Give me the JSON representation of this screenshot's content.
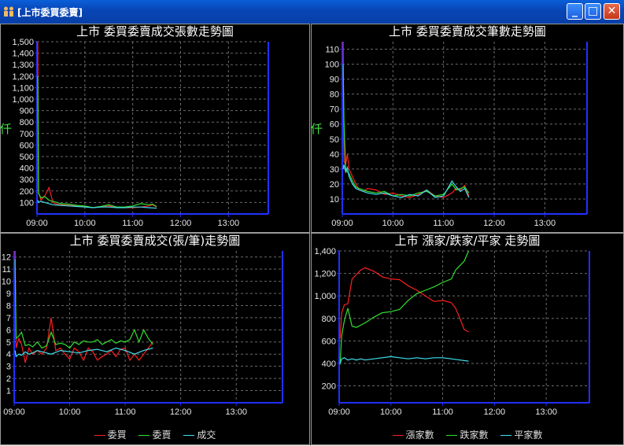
{
  "window": {
    "title": "[上市委買委賣]",
    "minimize_glyph": "_",
    "maximize_glyph": "□",
    "close_glyph": "✕"
  },
  "chart_data": [
    {
      "type": "line",
      "title": "上市 委買委賣成交張數走勢圖",
      "ylabel": "仟",
      "ylim": [
        0,
        1500
      ],
      "yticks": [
        100,
        200,
        300,
        400,
        500,
        600,
        700,
        800,
        900,
        1000,
        1100,
        1200,
        1300,
        1400,
        1500
      ],
      "ytick_labels": [
        "100",
        "200",
        "300",
        "400",
        "500",
        "600",
        "700",
        "800",
        "900",
        "1,000",
        "1,100",
        "1,200",
        "1,300",
        "1,400",
        "1,500"
      ],
      "xticks": [
        "09:00",
        "10:00",
        "11:00",
        "12:00",
        "13:00"
      ],
      "xlim": [
        "09:00",
        "13:50"
      ],
      "grid": true,
      "series": [
        {
          "color": "#ff2020",
          "x": [
            "09:01",
            "09:02",
            "09:05",
            "09:10",
            "09:15",
            "09:20",
            "09:25",
            "09:30",
            "09:40",
            "09:50",
            "10:00",
            "10:10",
            "10:20",
            "10:30",
            "10:40",
            "10:50",
            "11:00",
            "11:10",
            "11:20",
            "11:25",
            "11:30"
          ],
          "values": [
            1500,
            190,
            120,
            160,
            230,
            100,
            85,
            80,
            75,
            70,
            65,
            55,
            60,
            70,
            60,
            55,
            55,
            60,
            70,
            80,
            60
          ]
        },
        {
          "color": "#30e030",
          "x": [
            "09:01",
            "09:02",
            "09:05",
            "09:10",
            "09:15",
            "09:20",
            "09:25",
            "09:30",
            "09:40",
            "09:50",
            "10:00",
            "10:10",
            "10:20",
            "10:30",
            "10:40",
            "10:50",
            "11:00",
            "11:10",
            "11:20",
            "11:25",
            "11:30"
          ],
          "values": [
            1200,
            180,
            140,
            150,
            120,
            110,
            100,
            90,
            85,
            75,
            70,
            55,
            65,
            80,
            60,
            60,
            70,
            90,
            80,
            85,
            65
          ]
        },
        {
          "color": "#40e0f0",
          "x": [
            "09:01",
            "09:02",
            "09:05",
            "09:10",
            "09:15",
            "09:20",
            "09:30",
            "09:40",
            "09:50",
            "10:00",
            "10:10",
            "10:20",
            "10:30",
            "10:40",
            "10:50",
            "11:00",
            "11:10",
            "11:20",
            "11:30"
          ],
          "values": [
            120,
            100,
            110,
            100,
            90,
            80,
            75,
            70,
            65,
            60,
            55,
            60,
            60,
            55,
            55,
            60,
            60,
            55,
            50
          ]
        }
      ]
    },
    {
      "type": "line",
      "title": "上市 委買委賣成交筆數走勢圖",
      "ylabel": "仟",
      "ylim": [
        0,
        115
      ],
      "yticks": [
        10,
        20,
        30,
        40,
        50,
        60,
        70,
        80,
        90,
        100,
        110
      ],
      "ytick_labels": [
        "10",
        "20",
        "30",
        "40",
        "50",
        "60",
        "70",
        "80",
        "90",
        "100",
        "110"
      ],
      "xticks": [
        "09:00",
        "10:00",
        "11:00",
        "12:00",
        "13:00"
      ],
      "xlim": [
        "09:00",
        "13:50"
      ],
      "grid": true,
      "series": [
        {
          "color": "#ff2020",
          "x": [
            "09:01",
            "09:02",
            "09:04",
            "09:06",
            "09:08",
            "09:12",
            "09:16",
            "09:20",
            "09:25",
            "09:30",
            "09:40",
            "09:50",
            "10:00",
            "10:10",
            "10:20",
            "10:30",
            "10:40",
            "10:50",
            "11:00",
            "11:10",
            "11:15",
            "11:20",
            "11:25",
            "11:30"
          ],
          "values": [
            115,
            35,
            33,
            40,
            30,
            25,
            20,
            16,
            15,
            17,
            16,
            13,
            14,
            12,
            11,
            13,
            16,
            12,
            11,
            14,
            17,
            16,
            19,
            12
          ]
        },
        {
          "color": "#30e030",
          "x": [
            "09:01",
            "09:02",
            "09:04",
            "09:06",
            "09:08",
            "09:12",
            "09:16",
            "09:20",
            "09:25",
            "09:30",
            "09:40",
            "09:50",
            "10:00",
            "10:10",
            "10:20",
            "10:30",
            "10:40",
            "10:50",
            "11:00",
            "11:10",
            "11:15",
            "11:20",
            "11:25",
            "11:30"
          ],
          "values": [
            100,
            62,
            30,
            28,
            27,
            22,
            18,
            17,
            16,
            15,
            14,
            15,
            12,
            13,
            12,
            14,
            15,
            12,
            13,
            20,
            16,
            17,
            18,
            14
          ]
        },
        {
          "color": "#40e0f0",
          "x": [
            "09:01",
            "09:02",
            "09:04",
            "09:06",
            "09:08",
            "09:12",
            "09:16",
            "09:20",
            "09:25",
            "09:30",
            "09:40",
            "09:50",
            "10:00",
            "10:10",
            "10:20",
            "10:30",
            "10:40",
            "10:50",
            "11:00",
            "11:10",
            "11:15",
            "11:20",
            "11:25",
            "11:30"
          ],
          "values": [
            30,
            33,
            28,
            31,
            25,
            20,
            17,
            16,
            15,
            14,
            13,
            14,
            12,
            11,
            13,
            12,
            16,
            11,
            12,
            22,
            18,
            15,
            17,
            11
          ]
        }
      ]
    },
    {
      "type": "line",
      "title": "上市 委買委賣成交(張/筆)走勢圖",
      "ylim": [
        0,
        12.5
      ],
      "yticks": [
        1,
        2,
        3,
        4,
        5,
        6,
        7,
        8,
        9,
        10,
        11,
        12
      ],
      "ytick_labels": [
        "1",
        "2",
        "3",
        "4",
        "5",
        "6",
        "7",
        "8",
        "9",
        "10",
        "11",
        "12"
      ],
      "xticks": [
        "09:00",
        "10:00",
        "11:00",
        "12:00",
        "13:00"
      ],
      "xlim": [
        "09:00",
        "13:50"
      ],
      "grid": true,
      "legend": [
        "委買",
        "委賣",
        "成交"
      ],
      "legend_position": "bottom",
      "series": [
        {
          "name": "委買",
          "color": "#ff2020",
          "x": [
            "09:01",
            "09:02",
            "09:05",
            "09:08",
            "09:12",
            "09:16",
            "09:20",
            "09:25",
            "09:30",
            "09:35",
            "09:40",
            "09:45",
            "09:50",
            "09:55",
            "10:00",
            "10:05",
            "10:10",
            "10:15",
            "10:20",
            "10:25",
            "10:30",
            "10:35",
            "10:40",
            "10:45",
            "10:50",
            "10:55",
            "11:00",
            "11:05",
            "11:10",
            "11:15",
            "11:20",
            "11:25",
            "11:30"
          ],
          "values": [
            12.5,
            4.5,
            5.3,
            4.8,
            3.3,
            4.5,
            4.0,
            4.3,
            4.0,
            4.5,
            7.0,
            4.3,
            4.5,
            4.0,
            3.6,
            4.5,
            4.2,
            3.5,
            4.5,
            4.2,
            3.5,
            3.8,
            4.0,
            4.3,
            3.8,
            4.4,
            4.5,
            3.5,
            4.0,
            3.5,
            4.0,
            4.5,
            5.0
          ]
        },
        {
          "name": "委賣",
          "color": "#30e030",
          "x": [
            "09:01",
            "09:02",
            "09:05",
            "09:08",
            "09:12",
            "09:16",
            "09:20",
            "09:25",
            "09:30",
            "09:35",
            "09:40",
            "09:45",
            "09:50",
            "09:55",
            "10:00",
            "10:05",
            "10:10",
            "10:15",
            "10:20",
            "10:25",
            "10:30",
            "10:35",
            "10:40",
            "10:45",
            "10:50",
            "10:55",
            "11:00",
            "11:05",
            "11:10",
            "11:15",
            "11:20",
            "11:25",
            "11:30"
          ],
          "values": [
            11.8,
            5.3,
            5.5,
            5.8,
            4.7,
            4.8,
            4.6,
            5.0,
            4.5,
            4.7,
            5.8,
            4.8,
            4.9,
            4.8,
            4.5,
            5.0,
            4.8,
            5.1,
            5.0,
            5.0,
            5.2,
            4.8,
            5.0,
            5.2,
            4.9,
            5.1,
            5.0,
            5.2,
            6.0,
            5.0,
            6.0,
            5.3,
            4.8
          ]
        },
        {
          "name": "成交",
          "color": "#40e0f0",
          "x": [
            "09:01",
            "09:02",
            "09:05",
            "09:08",
            "09:12",
            "09:16",
            "09:20",
            "09:25",
            "09:30",
            "09:40",
            "09:50",
            "10:00",
            "10:10",
            "10:20",
            "10:30",
            "10:40",
            "10:50",
            "11:00",
            "11:10",
            "11:20",
            "11:30"
          ],
          "values": [
            4.3,
            3.8,
            4.0,
            3.9,
            4.2,
            4.0,
            4.1,
            4.3,
            4.2,
            4.0,
            4.3,
            4.2,
            4.1,
            4.3,
            4.4,
            4.2,
            4.5,
            4.3,
            4.0,
            4.3,
            4.5
          ]
        }
      ]
    },
    {
      "type": "line",
      "title": "上市 漲家/跌家/平家 走勢圖",
      "ylim": [
        50,
        1400
      ],
      "yticks": [
        200,
        400,
        600,
        800,
        1000,
        1200,
        1400
      ],
      "ytick_labels": [
        "200",
        "400",
        "600",
        "800",
        "1,000",
        "1,200",
        "1,400"
      ],
      "xticks": [
        "09:00",
        "10:00",
        "11:00",
        "12:00",
        "13:00"
      ],
      "xlim": [
        "09:00",
        "13:50"
      ],
      "grid": true,
      "legend": [
        "漲家數",
        "跌家數",
        "平家數"
      ],
      "legend_position": "bottom",
      "series": [
        {
          "name": "漲家數",
          "color": "#ff2020",
          "x": [
            "09:01",
            "09:03",
            "09:06",
            "09:10",
            "09:15",
            "09:20",
            "09:25",
            "09:30",
            "09:40",
            "09:50",
            "10:00",
            "10:10",
            "10:20",
            "10:30",
            "10:40",
            "10:50",
            "11:00",
            "11:10",
            "11:15",
            "11:20",
            "11:25",
            "11:30"
          ],
          "values": [
            620,
            850,
            920,
            930,
            1150,
            1190,
            1230,
            1250,
            1220,
            1170,
            1150,
            1145,
            1090,
            1050,
            1000,
            950,
            960,
            940,
            890,
            800,
            700,
            680
          ]
        },
        {
          "name": "跌家數",
          "color": "#30e030",
          "x": [
            "09:01",
            "09:03",
            "09:06",
            "09:10",
            "09:15",
            "09:20",
            "09:25",
            "09:30",
            "09:40",
            "09:50",
            "10:00",
            "10:10",
            "10:20",
            "10:30",
            "10:40",
            "10:50",
            "11:00",
            "11:10",
            "11:15",
            "11:20",
            "11:25",
            "11:30"
          ],
          "values": [
            390,
            650,
            780,
            890,
            730,
            720,
            740,
            760,
            810,
            850,
            860,
            880,
            960,
            1020,
            1050,
            1080,
            1120,
            1150,
            1230,
            1270,
            1310,
            1400
          ]
        },
        {
          "name": "平家數",
          "color": "#40e0f0",
          "x": [
            "09:01",
            "09:03",
            "09:06",
            "09:10",
            "09:15",
            "09:20",
            "09:25",
            "09:30",
            "09:40",
            "09:50",
            "10:00",
            "10:10",
            "10:20",
            "10:30",
            "10:40",
            "10:50",
            "11:00",
            "11:10",
            "11:20",
            "11:30"
          ],
          "values": [
            400,
            440,
            450,
            430,
            440,
            430,
            440,
            430,
            440,
            450,
            460,
            450,
            440,
            450,
            440,
            450,
            450,
            440,
            430,
            420
          ]
        }
      ]
    }
  ]
}
